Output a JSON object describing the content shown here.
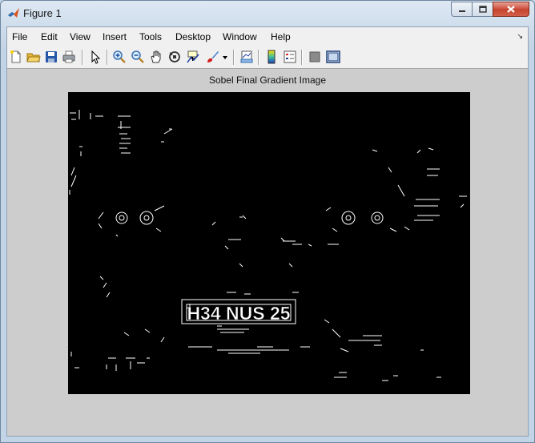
{
  "window": {
    "title": "Figure 1"
  },
  "menubar": {
    "items": [
      {
        "label": "File"
      },
      {
        "label": "Edit"
      },
      {
        "label": "View"
      },
      {
        "label": "Insert"
      },
      {
        "label": "Tools"
      },
      {
        "label": "Desktop"
      },
      {
        "label": "Window"
      },
      {
        "label": "Help"
      }
    ]
  },
  "toolbar": {
    "icons": [
      "new-figure-icon",
      "open-file-icon",
      "save-icon",
      "print-icon",
      "edit-plot-icon",
      "zoom-in-icon",
      "zoom-out-icon",
      "pan-icon",
      "rotate-3d-icon",
      "data-cursor-icon",
      "brush-icon",
      "link-plot-icon",
      "insert-colorbar-icon",
      "insert-legend-icon",
      "hide-plot-tools-icon",
      "show-plot-tools-icon"
    ]
  },
  "figure": {
    "plot_title": "Sobel Final Gradient Image",
    "plate_text": "H34 NUS 25"
  }
}
